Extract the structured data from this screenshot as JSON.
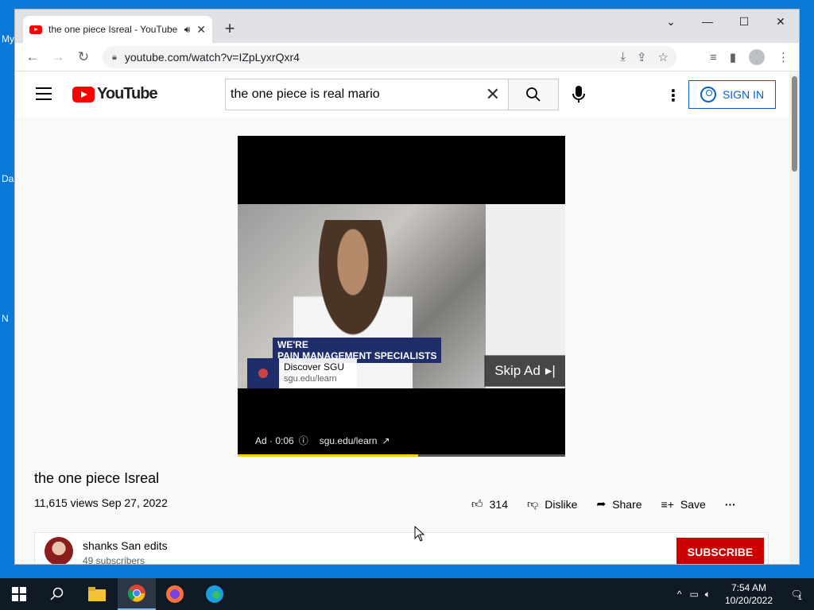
{
  "desktop": {
    "labels": [
      "My",
      "Da",
      "N"
    ]
  },
  "browser": {
    "tab": {
      "title": "the one piece Isreal - YouTube"
    },
    "url": "youtube.com/watch?v=IZpLyxrQxr4"
  },
  "youtube": {
    "search_query": "the one piece is real mario",
    "sign_in_label": "SIGN IN",
    "ad": {
      "banner_line1": "WE'RE",
      "banner_line2": "PAIN MANAGEMENT SPECIALISTS",
      "card_title": "Discover SGU",
      "card_url": "sgu.edu/learn",
      "skip_label": "Skip Ad",
      "ad_time": "Ad · 0:06",
      "ad_link": "sgu.edu/learn",
      "progress_fraction": 0.55
    },
    "video": {
      "title": "the one piece Isreal",
      "views_date": "11,615 views  Sep 27, 2022",
      "likes": "314",
      "dislike_label": "Dislike",
      "share_label": "Share",
      "save_label": "Save"
    },
    "channel": {
      "name": "shanks San edits",
      "subscribers": "49 subscribers",
      "subscribe_label": "SUBSCRIBE"
    }
  },
  "taskbar": {
    "time": "7:54 AM",
    "date": "10/20/2022",
    "notifications": "1"
  }
}
